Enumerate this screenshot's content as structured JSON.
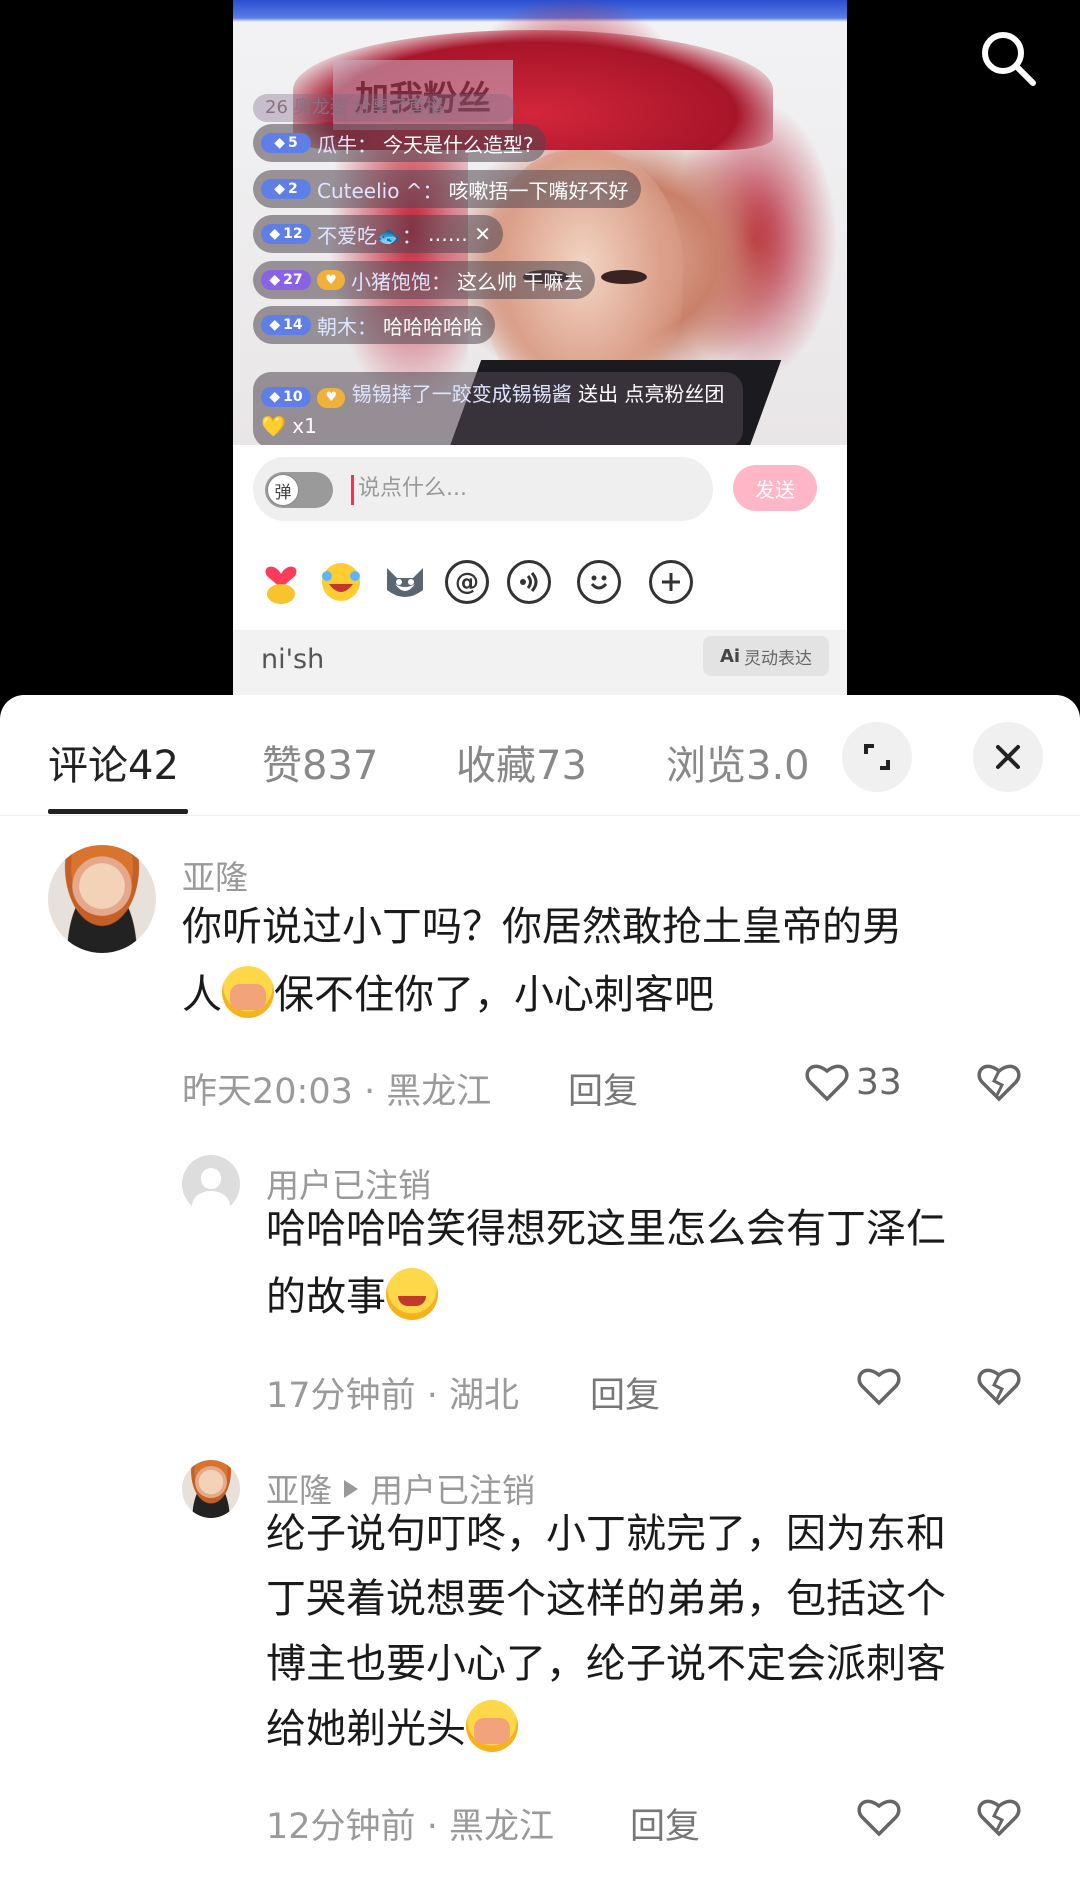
{
  "video": {
    "banner_text": "加我粉丝",
    "ghost_row": "26 奥龙姿 分享了直播",
    "chat": [
      {
        "level": "5",
        "name": "瓜牛：",
        "message": "今天是什么造型?"
      },
      {
        "level": "2",
        "name": "Cuteelio ^：",
        "message": "咳嗽捂一下嘴好不好"
      },
      {
        "level": "12",
        "name": "不爱吃🐟：",
        "message": "…… ✕"
      },
      {
        "level": "27",
        "name": "小猪饱饱：",
        "message": "这么帅 干嘛去"
      },
      {
        "level": "14",
        "name": "朝木：",
        "message": "哈哈哈哈哈"
      }
    ],
    "gift": {
      "level": "10",
      "name": "锡锡摔了一跤变成锡锡酱",
      "text": "送出 点亮粉丝团💛 x1"
    },
    "input": {
      "toggle_label": "弹",
      "placeholder": "说点什么...",
      "send_label": "发送"
    },
    "tools": {
      "at": "@"
    },
    "ime": {
      "text": "ni'sh",
      "ai_prefix": "Ai",
      "ai_label": "灵动表达"
    }
  },
  "sheet": {
    "tabs": [
      {
        "label": "评论",
        "count": "42"
      },
      {
        "label": "赞",
        "count": "837"
      },
      {
        "label": "收藏",
        "count": "73"
      },
      {
        "label": "浏览",
        "count": "3.0"
      }
    ],
    "comments": [
      {
        "username": "亚隆",
        "text_1": "你听说过小丁吗？你居然敢抢土皇帝的男",
        "text_2_before": "人",
        "text_2_after": "保不住你了，小心刺客吧",
        "time": "昨天20:03",
        "location": "黑龙江",
        "reply_label": "回复",
        "likes": "33"
      },
      {
        "username": "用户已注销",
        "text_1": "哈哈哈哈笑得想死这里怎么会有丁泽仁",
        "text_2_before": "的故事",
        "time": "17分钟前",
        "location": "湖北",
        "reply_label": "回复"
      },
      {
        "username": "亚隆",
        "reply_to": "用户已注销",
        "text_1": "纶子说句叮咚，小丁就完了，因为东和",
        "text_2": "丁哭着说想要个这样的弟弟，包括这个",
        "text_3": "博主也要小心了，纶子说不定会派刺客",
        "text_4_before": "给她剃光头",
        "time": "12分钟前",
        "location": "黑龙江",
        "reply_label": "回复"
      }
    ],
    "separator": "·"
  },
  "colors": {
    "send_button": "#ffb6c6",
    "level_badge": "#5f7fe6",
    "tab_active": "#222222"
  }
}
